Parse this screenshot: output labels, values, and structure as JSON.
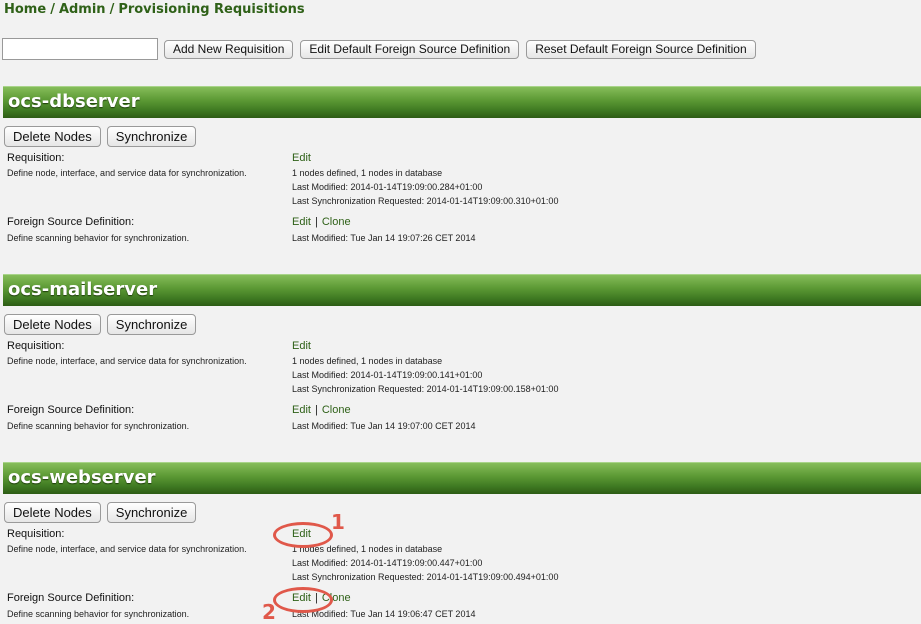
{
  "breadcrumb": {
    "home": "Home",
    "admin": "Admin",
    "current": "Provisioning Requisitions",
    "separator": "/"
  },
  "toolbar": {
    "input_value": "",
    "add_label": "Add New Requisition",
    "edit_default_label": "Edit Default Foreign Source Definition",
    "reset_default_label": "Reset Default Foreign Source Definition"
  },
  "sections": [
    {
      "name": "ocs-dbserver",
      "delete_label": "Delete Nodes",
      "sync_label": "Synchronize",
      "req_label": "Requisition:",
      "req_desc": "Define node, interface, and service data for synchronization.",
      "req_edit": "Edit",
      "req_nodes": "1 nodes defined, 1 nodes in database",
      "req_modified": "Last Modified: 2014-01-14T19:09:00.284+01:00",
      "req_sync": "Last Synchronization Requested: 2014-01-14T19:09:00.310+01:00",
      "fs_label": "Foreign Source Definition:",
      "fs_desc": "Define scanning behavior for synchronization.",
      "fs_edit": "Edit",
      "fs_pipe": "|",
      "fs_clone": "Clone",
      "fs_modified": "Last Modified: Tue Jan 14 19:07:26 CET 2014"
    },
    {
      "name": "ocs-mailserver",
      "delete_label": "Delete Nodes",
      "sync_label": "Synchronize",
      "req_label": "Requisition:",
      "req_desc": "Define node, interface, and service data for synchronization.",
      "req_edit": "Edit",
      "req_nodes": "1 nodes defined, 1 nodes in database",
      "req_modified": "Last Modified: 2014-01-14T19:09:00.141+01:00",
      "req_sync": "Last Synchronization Requested: 2014-01-14T19:09:00.158+01:00",
      "fs_label": "Foreign Source Definition:",
      "fs_desc": "Define scanning behavior for synchronization.",
      "fs_edit": "Edit",
      "fs_pipe": "|",
      "fs_clone": "Clone",
      "fs_modified": "Last Modified: Tue Jan 14 19:07:00 CET 2014"
    },
    {
      "name": "ocs-webserver",
      "delete_label": "Delete Nodes",
      "sync_label": "Synchronize",
      "req_label": "Requisition:",
      "req_desc": "Define node, interface, and service data for synchronization.",
      "req_edit": "Edit",
      "req_nodes": "1 nodes defined, 1 nodes in database",
      "req_modified": "Last Modified: 2014-01-14T19:09:00.447+01:00",
      "req_sync": "Last Synchronization Requested: 2014-01-14T19:09:00.494+01:00",
      "fs_label": "Foreign Source Definition:",
      "fs_desc": "Define scanning behavior for synchronization.",
      "fs_edit": "Edit",
      "fs_pipe": "|",
      "fs_clone": "Clone",
      "fs_modified": "Last Modified: Tue Jan 14 19:06:47 CET 2014"
    }
  ],
  "annotations": {
    "one": "1",
    "two": "2"
  },
  "colors": {
    "header_green": "#3f7a22",
    "link_green": "#2f6118",
    "annotation_red": "#e0584a"
  }
}
